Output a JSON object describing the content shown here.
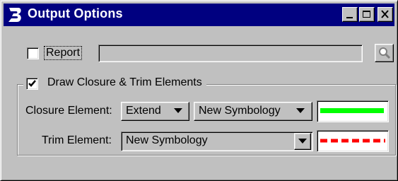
{
  "window": {
    "title": "Output Options",
    "app_icon": "bentley-b-logo"
  },
  "titlebar_buttons": [
    "minimize-icon",
    "maximize-icon",
    "close-icon"
  ],
  "report": {
    "label": "Report",
    "checked": false,
    "value": "",
    "browse_icon": "magnifier-icon"
  },
  "draw_closure": {
    "label": "Draw Closure & Trim Elements",
    "checked": true
  },
  "closure": {
    "label": "Closure Element:",
    "mode": "Extend",
    "symbology": "New Symbology",
    "line_color": "#00ff00",
    "line_style": "solid"
  },
  "trim": {
    "label": "Trim Element:",
    "symbology": "New Symbology",
    "line_color": "#ff0000",
    "line_style": "dashed"
  }
}
